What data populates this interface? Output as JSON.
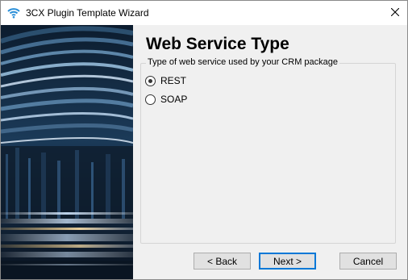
{
  "window": {
    "title": "3CX Plugin Template Wizard",
    "icon": "3cx-wifi-icon",
    "close_icon": "close-icon"
  },
  "page": {
    "title": "Web Service Type"
  },
  "service_group": {
    "legend": "Type of web service used by your CRM package",
    "options": [
      {
        "label": "REST",
        "selected": true
      },
      {
        "label": "SOAP",
        "selected": false
      }
    ]
  },
  "buttons": {
    "back": "< Back",
    "next": "Next >",
    "cancel": "Cancel"
  },
  "colors": {
    "accent": "#0078d7",
    "window_bg": "#f0f0f0",
    "titlebar_bg": "#ffffff"
  }
}
